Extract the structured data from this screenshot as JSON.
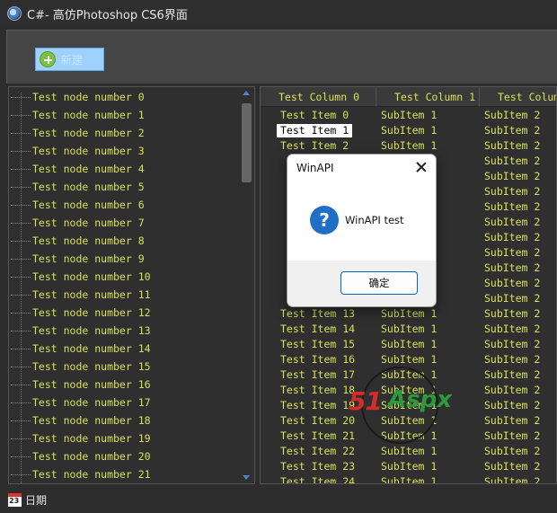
{
  "window": {
    "title": "C#- 高仿Photoshop CS6界面"
  },
  "toolbar": {
    "new_label": "新建"
  },
  "tree": {
    "nodes": [
      "Test node number 0",
      "Test node number 1",
      "Test node number 2",
      "Test node number 3",
      "Test node number 4",
      "Test node number 5",
      "Test node number 6",
      "Test node number 7",
      "Test node number 8",
      "Test node number 9",
      "Test node number 10",
      "Test node number 11",
      "Test node number 12",
      "Test node number 13",
      "Test node number 14",
      "Test node number 15",
      "Test node number 16",
      "Test node number 17",
      "Test node number 18",
      "Test node number 19",
      "Test node number 20",
      "Test node number 21"
    ]
  },
  "list": {
    "columns": [
      "Test Column 0",
      "Test Column 1",
      "Test Column"
    ],
    "selected_row": 1,
    "rows": [
      [
        "Test Item 0",
        "SubItem 1",
        "SubItem 2"
      ],
      [
        "Test Item 1",
        "SubItem 1",
        "SubItem 2"
      ],
      [
        "Test Item 2",
        "SubItem 1",
        "SubItem 2"
      ],
      [
        "",
        "",
        "SubItem 2"
      ],
      [
        "",
        "",
        "SubItem 2"
      ],
      [
        "",
        "",
        "SubItem 2"
      ],
      [
        "",
        "",
        "SubItem 2"
      ],
      [
        "",
        "",
        "SubItem 2"
      ],
      [
        "",
        "",
        "SubItem 2"
      ],
      [
        "",
        "",
        "SubItem 2"
      ],
      [
        "",
        "",
        "SubItem 2"
      ],
      [
        "",
        "",
        "SubItem 2"
      ],
      [
        "",
        "",
        "SubItem 2"
      ],
      [
        "Test Item 13",
        "SubItem 1",
        "SubItem 2"
      ],
      [
        "Test Item 14",
        "SubItem 1",
        "SubItem 2"
      ],
      [
        "Test Item 15",
        "SubItem 1",
        "SubItem 2"
      ],
      [
        "Test Item 16",
        "SubItem 1",
        "SubItem 2"
      ],
      [
        "Test Item 17",
        "SubItem 1",
        "SubItem 2"
      ],
      [
        "Test Item 18",
        "SubItem 1",
        "SubItem 2"
      ],
      [
        "Test Item 19",
        "SubItem 1",
        "SubItem 2"
      ],
      [
        "Test Item 20",
        "SubItem 1",
        "SubItem 2"
      ],
      [
        "Test Item 21",
        "SubItem 1",
        "SubItem 2"
      ],
      [
        "Test Item 22",
        "SubItem 1",
        "SubItem 2"
      ],
      [
        "Test Item 23",
        "SubItem 1",
        "SubItem 2"
      ],
      [
        "Test Item 24",
        "SubItem 1",
        "SubItem 2"
      ]
    ]
  },
  "dialog": {
    "title": "WinAPI",
    "message": "WinAPI test",
    "ok_label": "确定"
  },
  "watermark": {
    "text_red": "51",
    "text_green": "Aspx"
  },
  "status": {
    "text": "日期"
  },
  "colors": {
    "tree_text": "#d8e25a",
    "list_text": "#d8e25a",
    "selection_bg": "#ffffff",
    "dialog_icon": "#1f6fc9",
    "ok_border": "#0067c0"
  },
  "icons": {
    "app": "globe-icon",
    "new": "plus-circle-icon",
    "status": "calendar-icon",
    "dialog": "question-icon"
  }
}
